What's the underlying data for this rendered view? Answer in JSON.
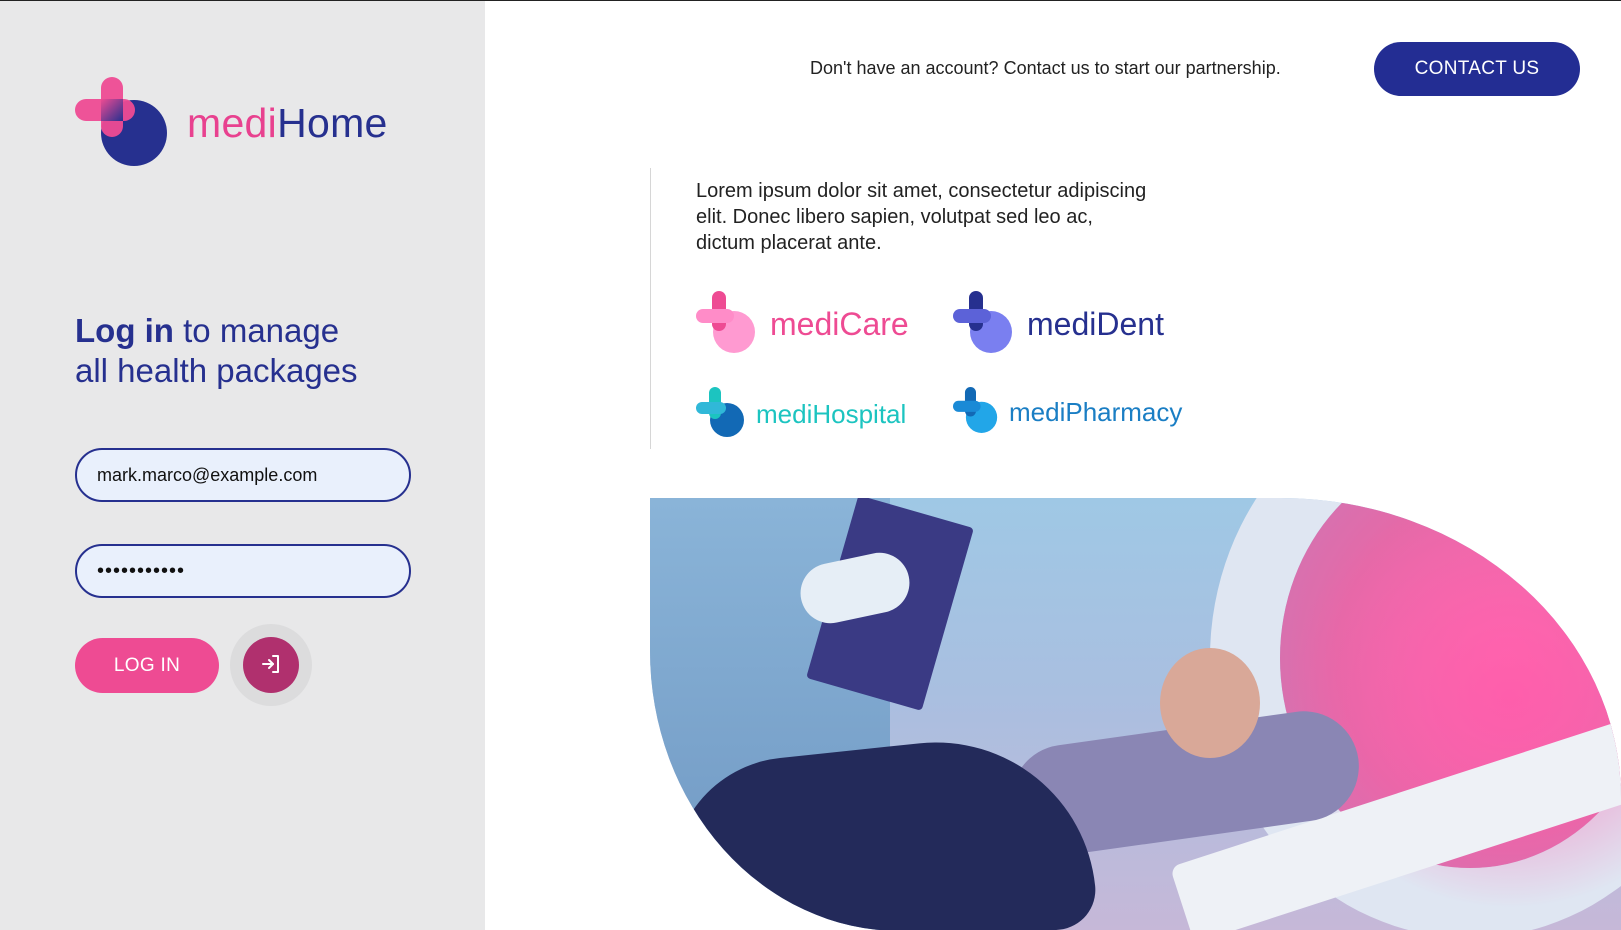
{
  "brand": {
    "part1": "medi",
    "part2": "Home"
  },
  "login": {
    "headline_strong": "Log in",
    "headline_rest1": " to manage",
    "headline_rest2": "all health packages",
    "email_value": "mark.marco@example.com",
    "password_value": "•••••••••••",
    "login_button": "LOG IN"
  },
  "header": {
    "prompt": "Don't have an account? Contact us to start our partnership.",
    "contact_button": "CONTACT US"
  },
  "intro": {
    "text": "Lorem ipsum dolor sit amet, consectetur adipiscing elit. Donec libero sapien, volutpat sed leo ac, dictum placerat ante."
  },
  "brands": [
    {
      "name": "mediCare"
    },
    {
      "name": "mediDent"
    },
    {
      "name": "mediHospital"
    },
    {
      "name": "mediPharmacy"
    }
  ],
  "colors": {
    "pink": "#ee4b93",
    "navy": "#26308f",
    "button_navy": "#232d93",
    "plum": "#b0306e",
    "left_panel": "#e8e8e9",
    "input_bg": "#e9f0fc"
  },
  "icons": {
    "login_icon": "sign-in-icon"
  }
}
